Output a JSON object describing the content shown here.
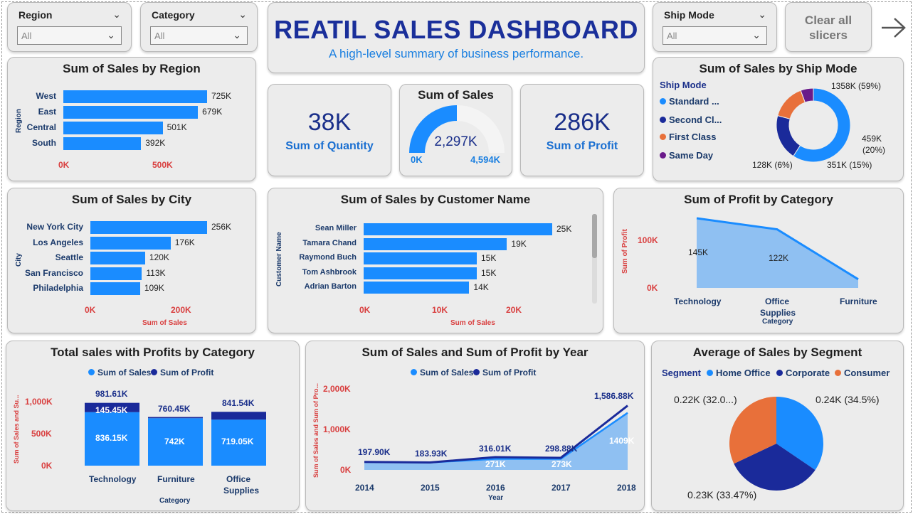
{
  "filters": {
    "region": {
      "label": "Region",
      "value": "All"
    },
    "category": {
      "label": "Category",
      "value": "All"
    },
    "ship_mode": {
      "label": "Ship Mode",
      "value": "All"
    },
    "clear_line1": "Clear all",
    "clear_line2": "slicers"
  },
  "header": {
    "title": "REATIL SALES DASHBOARD",
    "subtitle": "A high-level summary of business performance."
  },
  "kpis": {
    "quantity": {
      "value": "38K",
      "label": "Sum of Quantity"
    },
    "sales": {
      "title": "Sum of Sales",
      "value": "2,297K",
      "min": "0K",
      "max": "4,594K",
      "fraction": 0.5
    },
    "profit": {
      "value": "286K",
      "label": "Sum of Profit"
    }
  },
  "colors": {
    "bar": "#1a8cff",
    "dark": "#1a2a9a",
    "orange": "#e8703a",
    "purple": "#6a1a8a",
    "red_axis": "#d94040",
    "light_area": "#8fc0f2"
  },
  "charts": {
    "region": {
      "title": "Sum of Sales by Region",
      "ylabel": "Region",
      "ticks": [
        "0K",
        "500K"
      ],
      "chart_data": {
        "type": "bar",
        "categories": [
          "West",
          "East",
          "Central",
          "South"
        ],
        "values": [
          725,
          679,
          501,
          392
        ],
        "labels": [
          "725K",
          "679K",
          "501K",
          "392K"
        ],
        "xlim": [
          0,
          725
        ]
      }
    },
    "city": {
      "title": "Sum of Sales by City",
      "ylabel": "City",
      "xlabel": "Sum of Sales",
      "ticks": [
        "0K",
        "200K"
      ],
      "chart_data": {
        "type": "bar",
        "categories": [
          "New York City",
          "Los Angeles",
          "Seattle",
          "San Francisco",
          "Philadelphia"
        ],
        "values": [
          256,
          176,
          120,
          113,
          109
        ],
        "labels": [
          "256K",
          "176K",
          "120K",
          "113K",
          "109K"
        ]
      }
    },
    "customer": {
      "title": "Sum of Sales by Customer Name",
      "ylabel": "Customer Name",
      "xlabel": "Sum of Sales",
      "ticks": [
        "0K",
        "10K",
        "20K"
      ],
      "chart_data": {
        "type": "bar",
        "categories": [
          "Sean Miller",
          "Tamara Chand",
          "Raymond Buch",
          "Tom Ashbrook",
          "Adrian Barton"
        ],
        "values": [
          25,
          19,
          15,
          15,
          14
        ],
        "labels": [
          "25K",
          "19K",
          "15K",
          "15K",
          "14K"
        ]
      }
    },
    "shipmode": {
      "title": "Sum of Sales by Ship Mode",
      "legend_title": "Ship Mode",
      "legend": [
        "Standard ...",
        "Second Cl...",
        "First Class",
        "Same Day"
      ],
      "chart_data": {
        "type": "pie",
        "categories": [
          "Standard Class",
          "Second Class",
          "First Class",
          "Same Day"
        ],
        "values": [
          1358,
          459,
          351,
          128
        ],
        "labels": [
          "1358K (59%)",
          "459K",
          "(20%)",
          "351K (15%)",
          "128K (6%)"
        ]
      }
    },
    "profit_category": {
      "title": "Sum of Profit by Category",
      "ylabel": "Sum of Profit",
      "xlabel": "Category",
      "ticks": [
        "100K",
        "0K"
      ],
      "cat_labels": [
        "Technology",
        "Office",
        "Supplies",
        "Furniture"
      ],
      "chart_data": {
        "type": "area",
        "categories": [
          "Technology",
          "Office Supplies",
          "Furniture"
        ],
        "values": [
          145,
          122,
          18
        ],
        "labels": [
          "145K",
          "122K"
        ]
      }
    },
    "sales_profit_category": {
      "title": "Total sales with Profits by Category",
      "legend": [
        "Sum of Sales",
        "Sum of Profit"
      ],
      "ylabel": "Sum of Sales and Su...",
      "xlabel": "Category",
      "ticks": [
        "1,000K",
        "500K",
        "0K"
      ],
      "cat_labels": [
        "Technology",
        "Furniture",
        "Office",
        "Supplies"
      ],
      "chart_data": {
        "type": "bar",
        "categories": [
          "Technology",
          "Furniture",
          "Office Supplies"
        ],
        "series": [
          {
            "name": "Sum of Sales",
            "values": [
              836.15,
              742,
              719.05
            ]
          },
          {
            "name": "Sum of Profit",
            "values": [
              145.45,
              18.45,
              122.49
            ]
          }
        ],
        "labels": [
          "981.61K",
          "145.45K",
          "836.15K",
          "760.45K",
          "742K",
          "841.54K",
          "719.05K"
        ]
      }
    },
    "year": {
      "title": "Sum of Sales and Sum of Profit by Year",
      "legend": [
        "Sum of Sales",
        "Sum of Profit"
      ],
      "ylabel": "Sum of Sales and Sum of Pro...",
      "xlabel": "Year",
      "ticks": [
        "2,000K",
        "1,000K",
        "0K"
      ],
      "chart_data": {
        "type": "line",
        "x": [
          "2014",
          "2015",
          "2016",
          "2017",
          "2018"
        ],
        "series": [
          {
            "name": "Sum of Sales",
            "values": [
              197.9,
              183.93,
              271,
              273,
              1409
            ]
          },
          {
            "name": "Sum of Profit",
            "values": [
              197.9,
              183.93,
              316.01,
              298.88,
              1586.88
            ]
          }
        ],
        "labels": [
          "197.90K",
          "183.93K",
          "316.01K",
          "298.88K",
          "1,586.88K",
          "271K",
          "273K",
          "1409K"
        ]
      }
    },
    "segment": {
      "title": "Average of Sales by Segment",
      "legend_title": "Segment",
      "legend": [
        "Home Office",
        "Corporate",
        "Consumer"
      ],
      "chart_data": {
        "type": "pie",
        "categories": [
          "Home Office",
          "Corporate",
          "Consumer"
        ],
        "values": [
          34.5,
          33.47,
          32.03
        ],
        "labels": [
          "0.24K (34.5%)",
          "0.23K (33.47%)",
          "0.22K (32.0...)"
        ]
      }
    }
  }
}
